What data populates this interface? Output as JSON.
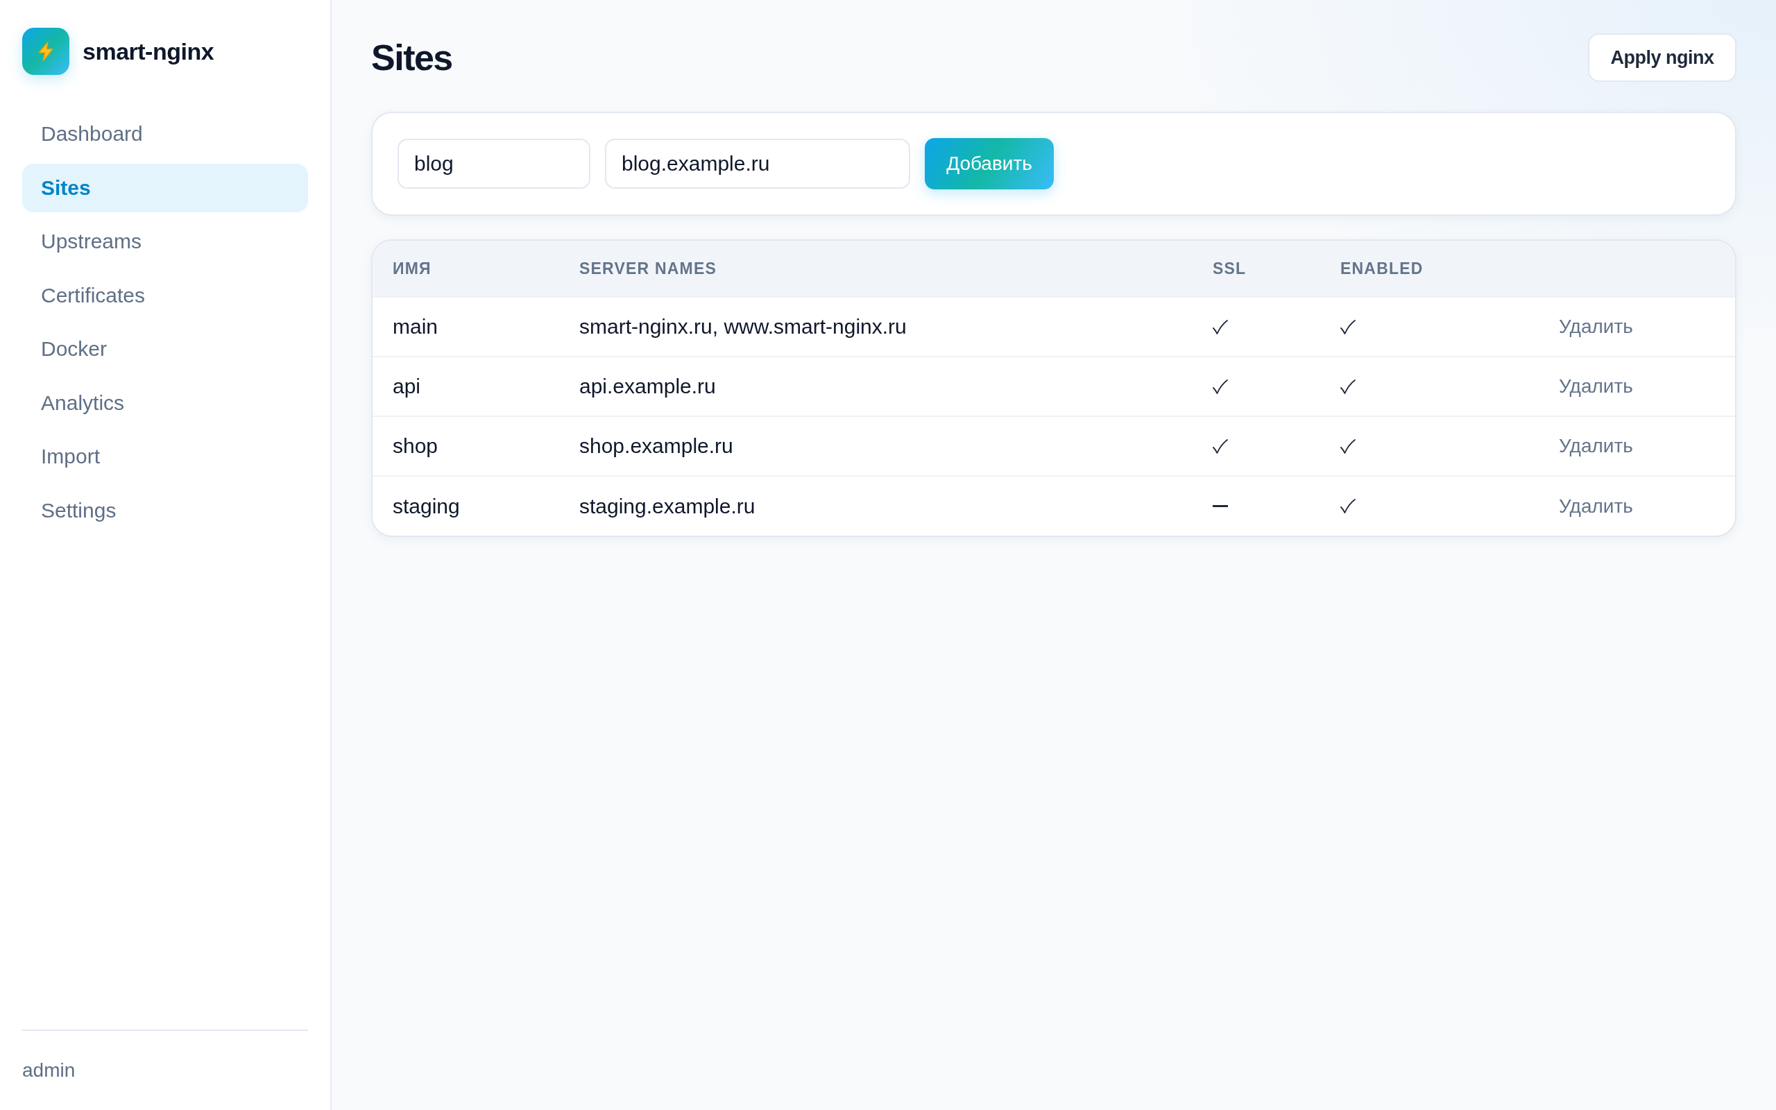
{
  "sidebar": {
    "brand": "smart-nginx",
    "items": [
      {
        "label": "Dashboard",
        "selected": false
      },
      {
        "label": "Sites",
        "selected": true
      },
      {
        "label": "Upstreams",
        "selected": false
      },
      {
        "label": "Certificates",
        "selected": false
      },
      {
        "label": "Docker",
        "selected": false
      },
      {
        "label": "Analytics",
        "selected": false
      },
      {
        "label": "Import",
        "selected": false
      },
      {
        "label": "Settings",
        "selected": false
      }
    ],
    "user": "admin"
  },
  "header": {
    "title": "Sites",
    "apply_button": "Apply nginx"
  },
  "add_form": {
    "name_field": {
      "value": "blog"
    },
    "server_names_field": {
      "value": "blog.example.ru"
    },
    "submit_button": "Добавить"
  },
  "table": {
    "columns": [
      "ИМЯ",
      "SERVER NAMES",
      "SSL",
      "ENABLED"
    ],
    "rows": [
      {
        "name": "main",
        "server_names": "smart-nginx.ru, www.smart-nginx.ru",
        "ssl": true,
        "enabled": true,
        "action": "Удалить"
      },
      {
        "name": "api",
        "server_names": "api.example.ru",
        "ssl": true,
        "enabled": true,
        "action": "Удалить"
      },
      {
        "name": "shop",
        "server_names": "shop.example.ru",
        "ssl": true,
        "enabled": true,
        "action": "Удалить"
      },
      {
        "name": "staging",
        "server_names": "staging.example.ru",
        "ssl": false,
        "enabled": true,
        "action": "Удалить"
      }
    ]
  }
}
